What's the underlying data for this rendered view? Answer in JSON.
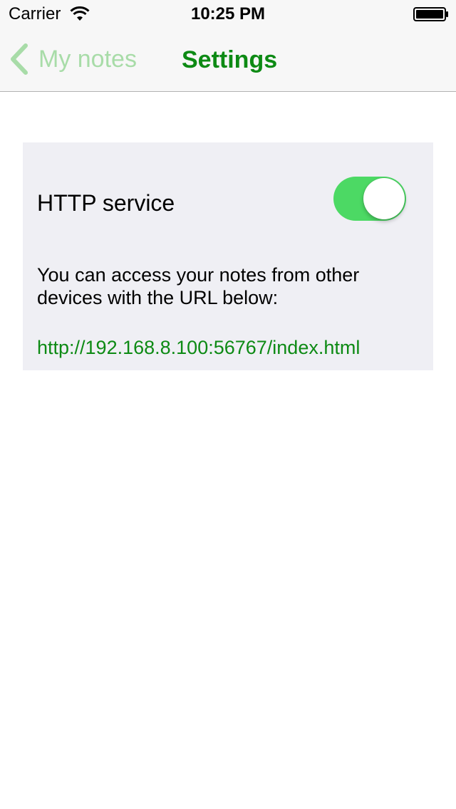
{
  "status_bar": {
    "carrier": "Carrier",
    "time": "10:25 PM",
    "wifi_icon": "wifi-icon",
    "battery_icon": "battery-icon"
  },
  "nav": {
    "back_label": "My notes",
    "back_icon": "chevron-left-icon",
    "title": "Settings"
  },
  "settings": {
    "http_service_label": "HTTP service",
    "http_service_enabled": true,
    "description": "You can access your notes from other devices with the URL below:",
    "url": "http://192.168.8.100:56767/index.html"
  },
  "colors": {
    "accent": "#0d8a14",
    "accent_light": "#a8dca8",
    "toggle_on": "#4cd964",
    "card_bg": "#efeff4",
    "bar_bg": "#f7f7f7"
  }
}
